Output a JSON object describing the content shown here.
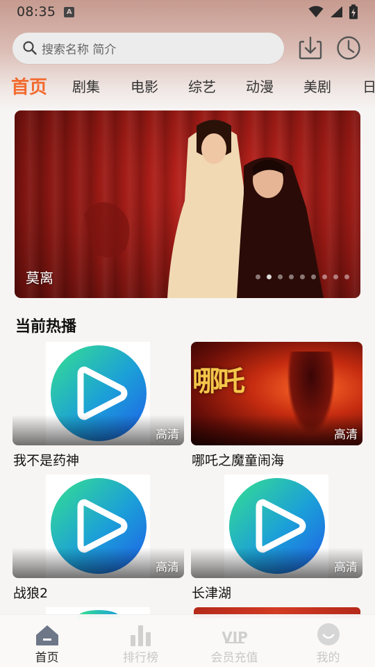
{
  "status_bar": {
    "time": "08:35",
    "notification_icon": "a-badge-icon",
    "icons": [
      "wifi-icon",
      "signal-icon",
      "battery-charging-icon"
    ]
  },
  "search": {
    "placeholder": "搜索名称 简介",
    "icon": "search-icon"
  },
  "header_buttons": {
    "download_icon": "download-icon",
    "history_icon": "clock-icon"
  },
  "tabs": [
    {
      "label": "首页",
      "active": true
    },
    {
      "label": "剧集",
      "active": false
    },
    {
      "label": "电影",
      "active": false
    },
    {
      "label": "综艺",
      "active": false
    },
    {
      "label": "动漫",
      "active": false
    },
    {
      "label": "美剧",
      "active": false
    },
    {
      "label": "日",
      "active": false
    }
  ],
  "banner": {
    "title": "莫离",
    "slide_count": 9,
    "active_slide": 1
  },
  "hot_section": {
    "title": "当前热播",
    "items": [
      {
        "name": "我不是药神",
        "quality": "高清",
        "thumb": "play-logo"
      },
      {
        "name": "哪吒之魔童闹海",
        "quality": "高清",
        "thumb": "poster",
        "poster_text": "哪吒"
      },
      {
        "name": "战狼2",
        "quality": "高清",
        "thumb": "play-logo"
      },
      {
        "name": "长津湖",
        "quality": "高清",
        "thumb": "play-logo"
      }
    ]
  },
  "bottom_nav": [
    {
      "label": "首页",
      "icon": "home-icon",
      "active": true
    },
    {
      "label": "排行榜",
      "icon": "bar-chart-icon",
      "active": false
    },
    {
      "label": "会员充值",
      "icon": "vip-icon",
      "active": false
    },
    {
      "label": "我的",
      "icon": "profile-icon",
      "active": false
    }
  ],
  "colors": {
    "accent": "#f26a2e",
    "banner_red": "#b81e17",
    "play_blue": "#1e73e8",
    "play_green": "#2fd39a"
  }
}
